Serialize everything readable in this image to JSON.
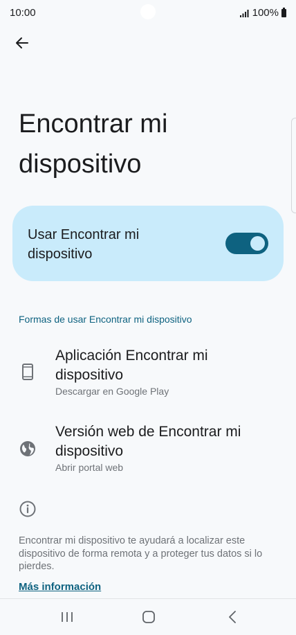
{
  "status_bar": {
    "time": "10:00",
    "battery": "100%",
    "signal_icon": "signal-icon",
    "battery_icon": "battery-icon"
  },
  "header": {
    "back_icon": "arrow-back-icon",
    "title": "Encontrar mi dispositivo"
  },
  "master_toggle": {
    "label": "Usar Encontrar mi dispositivo",
    "enabled": true,
    "accent_color": "#0e6280",
    "background_color": "#c9ebfb"
  },
  "section": {
    "header": "Formas de usar Encontrar mi dispositivo",
    "items": [
      {
        "icon": "phone-icon",
        "title": "Aplicación Encontrar mi dispositivo",
        "subtitle": "Descargar en Google Play"
      },
      {
        "icon": "globe-icon",
        "title": "Versión web de Encontrar mi dispositivo",
        "subtitle": "Abrir portal web"
      }
    ]
  },
  "info": {
    "icon": "info-icon",
    "text": "Encontrar mi dispositivo te ayudará a localizar este dispositivo de forma remota y a proteger tus datos si lo pierdes.",
    "link": "Más información"
  },
  "nav_bar": {
    "recents_icon": "recents-icon",
    "home_icon": "home-icon",
    "back_icon": "nav-back-icon"
  }
}
